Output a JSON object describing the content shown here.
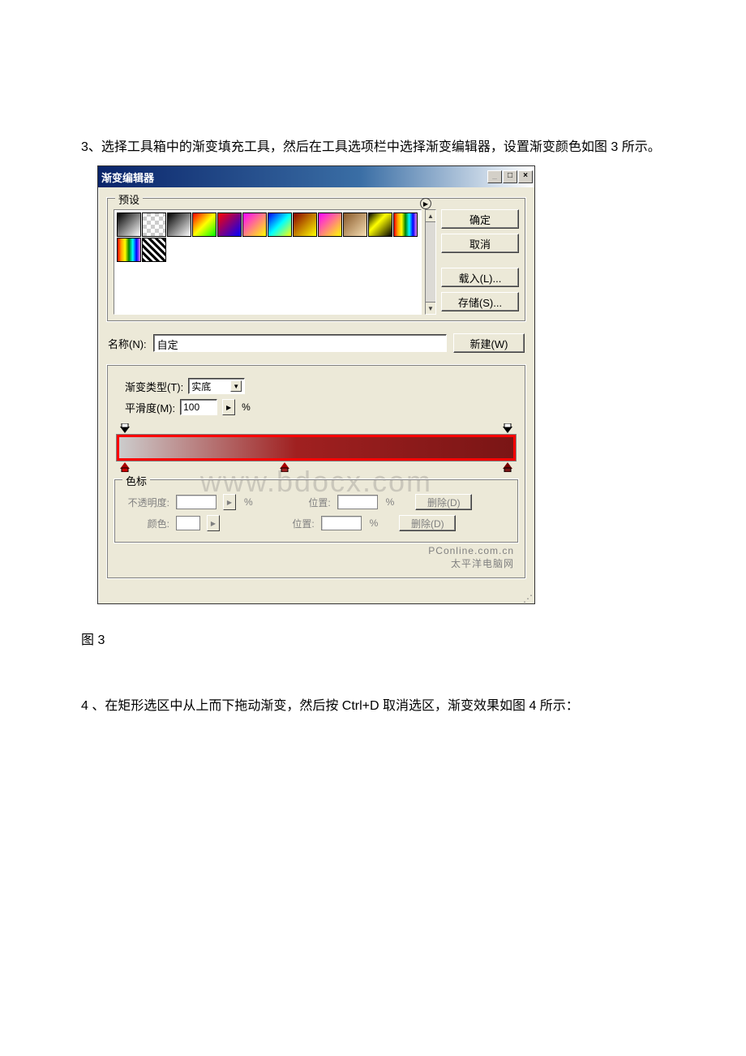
{
  "text": {
    "para3": "3、选择工具箱中的渐变填充工具，然后在工具选项栏中选择渐变编辑器，设置渐变颜色如图 3 所示。",
    "caption3": "图 3",
    "para4": "4 、在矩形选区中从上而下拖动渐变，然后按 Ctrl+D 取消选区，渐变效果如图 4 所示：",
    "watermark1": "www.bdocx.com",
    "watermark2_a": "PConline.com.cn",
    "watermark2_b": "太平洋电脑网"
  },
  "window": {
    "title": "渐变编辑器",
    "buttons": {
      "ok": "确定",
      "cancel": "取消",
      "load": "载入(L)...",
      "save": "存储(S)...",
      "new": "新建(W)"
    },
    "presets_label": "预设",
    "name_label": "名称(N):",
    "name_value": "自定",
    "grad_type_label": "渐变类型(T):",
    "grad_type_value": "实底",
    "smoothness_label": "平滑度(M):",
    "smoothness_value": "100",
    "pct": "%",
    "stops": {
      "legend": "色标",
      "opacity_label": "不透明度:",
      "color_label": "颜色:",
      "position_label": "位置:",
      "delete_label": "删除(D)"
    }
  }
}
